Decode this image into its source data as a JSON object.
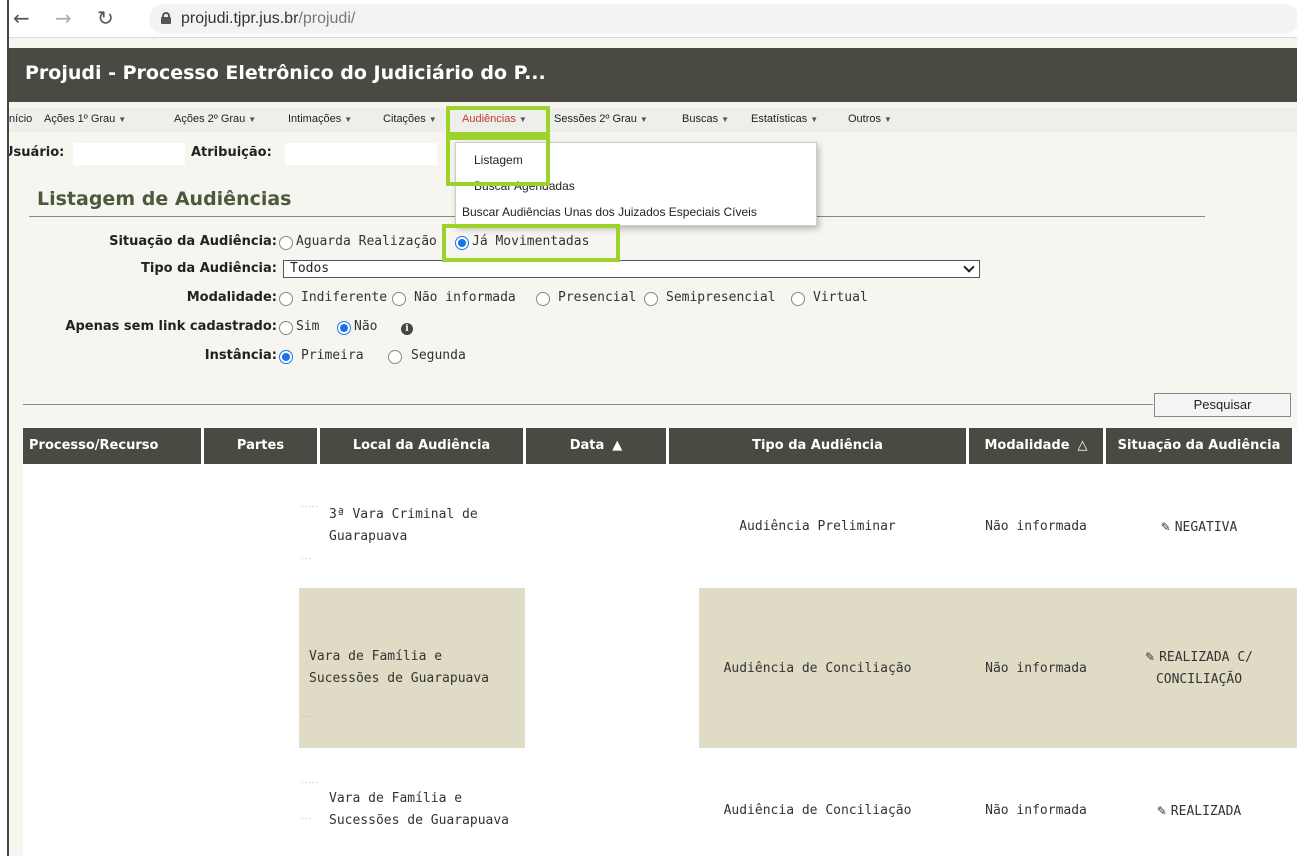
{
  "browser": {
    "url_host": "projudi.tjpr.jus.br",
    "url_path": "/projudi/"
  },
  "app": {
    "title": "Projudi - Processo Eletrônico do Judiciário do P..."
  },
  "menu": {
    "items": [
      {
        "label": "Início"
      },
      {
        "label": "Ações 1º Grau"
      },
      {
        "label": "Ações 2º Grau"
      },
      {
        "label": "Intimações"
      },
      {
        "label": "Citações"
      },
      {
        "label": "Audiências"
      },
      {
        "label": "Sessões 2º Grau"
      },
      {
        "label": "Buscas"
      },
      {
        "label": "Estatísticas"
      },
      {
        "label": "Outros"
      }
    ],
    "dropdown": {
      "items": [
        {
          "label": "Listagem"
        },
        {
          "label": "Buscar Agendadas"
        },
        {
          "label": "Buscar Audiências Unas dos Juizados Especiais Cíveis"
        }
      ]
    }
  },
  "user": {
    "usuario_label": "Usuário:",
    "atribuicao_label": "Atribuição:"
  },
  "section": {
    "title": "Listagem de Audiências"
  },
  "form": {
    "situacao": {
      "label": "Situação da Audiência:",
      "options": [
        "Aguarda Realização",
        "Já Movimentadas"
      ],
      "selected": "Já Movimentadas"
    },
    "tipo": {
      "label": "Tipo da Audiência:",
      "value": "Todos"
    },
    "modalidade": {
      "label": "Modalidade:",
      "options": [
        "Indiferente",
        "Não informada",
        "Presencial",
        "Semipresencial",
        "Virtual"
      ],
      "selected": ""
    },
    "sem_link": {
      "label": "Apenas sem link cadastrado:",
      "options": [
        "Sim",
        "Não"
      ],
      "selected": "Não"
    },
    "instancia": {
      "label": "Instância:",
      "options": [
        "Primeira",
        "Segunda"
      ],
      "selected": "Primeira"
    },
    "search_button": "Pesquisar"
  },
  "table": {
    "headers": [
      "Processo/Recurso",
      "Partes",
      "Local da Audiência",
      "Data",
      "Tipo da Audiência",
      "Modalidade",
      "Situação da Audiência"
    ],
    "rows": [
      {
        "local": [
          "3ª Vara Criminal de",
          "Guarapuava"
        ],
        "tipo": "Audiência Preliminar",
        "modalidade": "Não informada",
        "situacao": [
          "NEGATIVA"
        ]
      },
      {
        "local": [
          "Vara de Família e",
          "Sucessões de Guarapuava"
        ],
        "tipo": "Audiência de Conciliação",
        "modalidade": "Não informada",
        "situacao": [
          "REALIZADA C/",
          "CONCILIAÇÃO"
        ]
      },
      {
        "local": [
          "Vara de Família e",
          "Sucessões de Guarapuava"
        ],
        "tipo": "Audiência de Conciliação",
        "modalidade": "Não informada",
        "situacao": [
          "REALIZADA"
        ]
      }
    ]
  },
  "colors": {
    "header_bg": "#4a4a42",
    "highlight": "#9bd32a",
    "active_menu": "#c03a2b",
    "row_alt": "#e0dbc4"
  }
}
